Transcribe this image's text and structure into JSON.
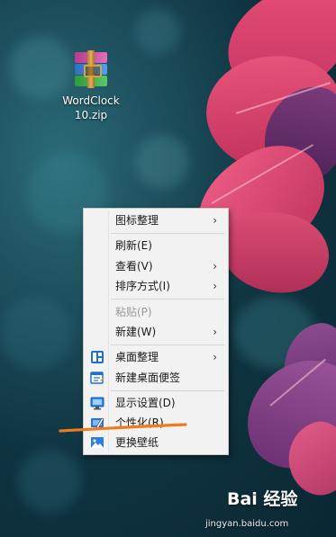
{
  "desktop": {
    "icon": {
      "name": "WordClock\n10.zip",
      "line1": "WordClock",
      "line2": "10.zip",
      "icon": "winrar-archive-icon"
    }
  },
  "context_menu": {
    "items": [
      {
        "label": "图标整理",
        "submenu": true,
        "icon": null
      },
      {
        "label": "刷新(E)",
        "submenu": false,
        "icon": null
      },
      {
        "label": "查看(V)",
        "submenu": true,
        "icon": null
      },
      {
        "label": "排序方式(I)",
        "submenu": true,
        "icon": null
      },
      {
        "label": "粘贴(P)",
        "submenu": false,
        "icon": null,
        "disabled": true
      },
      {
        "label": "新建(W)",
        "submenu": true,
        "icon": null
      },
      {
        "label": "桌面整理",
        "submenu": true,
        "icon": "desktop-organize-icon"
      },
      {
        "label": "新建桌面便签",
        "submenu": false,
        "icon": "sticky-note-icon"
      },
      {
        "label": "显示设置(D)",
        "submenu": false,
        "icon": "display-settings-icon"
      },
      {
        "label": "个性化(R)",
        "submenu": false,
        "icon": "personalize-icon"
      },
      {
        "label": "更换壁纸",
        "submenu": false,
        "icon": "wallpaper-icon"
      }
    ],
    "arrow_glyph": "›"
  },
  "annotation": {
    "color": "#f07a1c"
  },
  "watermark": {
    "logo": "Bai 经验",
    "url": "jingyan.baidu.com"
  },
  "colors": {
    "menu_bg": "#f2f2f2",
    "disabled_text": "#9a9a9a",
    "accent_blue": "#1f6fd1"
  }
}
